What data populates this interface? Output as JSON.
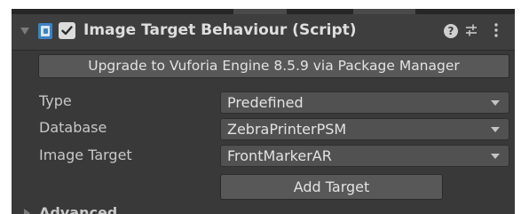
{
  "component": {
    "title": "Image Target Behaviour (Script)",
    "enabled": true,
    "icons": [
      "script-icon",
      "help-icon",
      "preset-icon",
      "menu-icon"
    ],
    "help_glyph": "?"
  },
  "upgrade_button": {
    "label": "Upgrade to Vuforia Engine 8.5.9 via Package Manager"
  },
  "fields": [
    {
      "label": "Type",
      "value": "Predefined"
    },
    {
      "label": "Database",
      "value": "ZebraPrinterPSM"
    },
    {
      "label": "Image Target",
      "value": "FrontMarkerAR"
    }
  ],
  "add_target_button": {
    "label": "Add Target"
  },
  "advanced": {
    "label": "Advanced"
  },
  "colors": {
    "panel_bg": "#393939",
    "header_bg": "#3e3e3e",
    "button_bg": "#585858",
    "dropdown_bg": "#515151",
    "script_icon_blue": "#3d82c4"
  }
}
